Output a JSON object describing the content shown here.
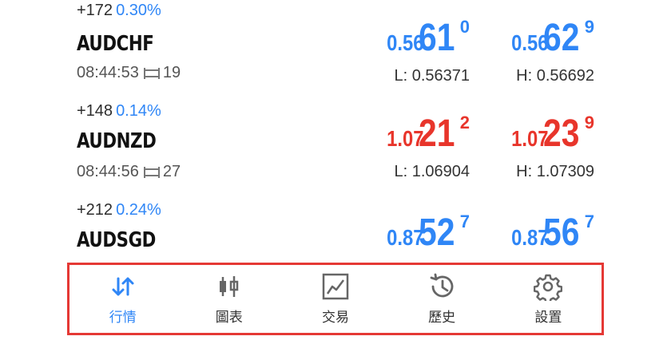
{
  "quotes": [
    {
      "change": "+172",
      "pct": "0.30%",
      "symbol": "AUDCHF",
      "time": "08:44:53",
      "spread": "19",
      "bid": {
        "lead": "0.56",
        "big": "61",
        "sup": "0"
      },
      "ask": {
        "lead": "0.56",
        "big": "62",
        "sup": "9"
      },
      "low": "L: 0.56371",
      "high": "H: 0.56692",
      "color": "#2f86f6"
    },
    {
      "change": "+148",
      "pct": "0.14%",
      "symbol": "AUDNZD",
      "time": "08:44:56",
      "spread": "27",
      "bid": {
        "lead": "1.07",
        "big": "21",
        "sup": "2"
      },
      "ask": {
        "lead": "1.07",
        "big": "23",
        "sup": "9"
      },
      "low": "L: 1.06904",
      "high": "H: 1.07309",
      "color": "#e8352b"
    },
    {
      "change": "+212",
      "pct": "0.24%",
      "symbol": "AUDSGD",
      "bid": {
        "lead": "0.87",
        "big": "52",
        "sup": "7"
      },
      "ask": {
        "lead": "0.87",
        "big": "56",
        "sup": "7"
      },
      "color": "#2f86f6"
    }
  ],
  "tabs": [
    {
      "label": "行情",
      "icon": "quotes-arrows-icon",
      "active": true
    },
    {
      "label": "圖表",
      "icon": "candlestick-chart-icon",
      "active": false
    },
    {
      "label": "交易",
      "icon": "trade-chart-icon",
      "active": false
    },
    {
      "label": "歷史",
      "icon": "history-clock-icon",
      "active": false
    },
    {
      "label": "設置",
      "icon": "gear-icon",
      "active": false
    }
  ],
  "colors": {
    "accent": "#2f86f6",
    "down": "#e8352b",
    "highlight_border": "#e53935"
  }
}
